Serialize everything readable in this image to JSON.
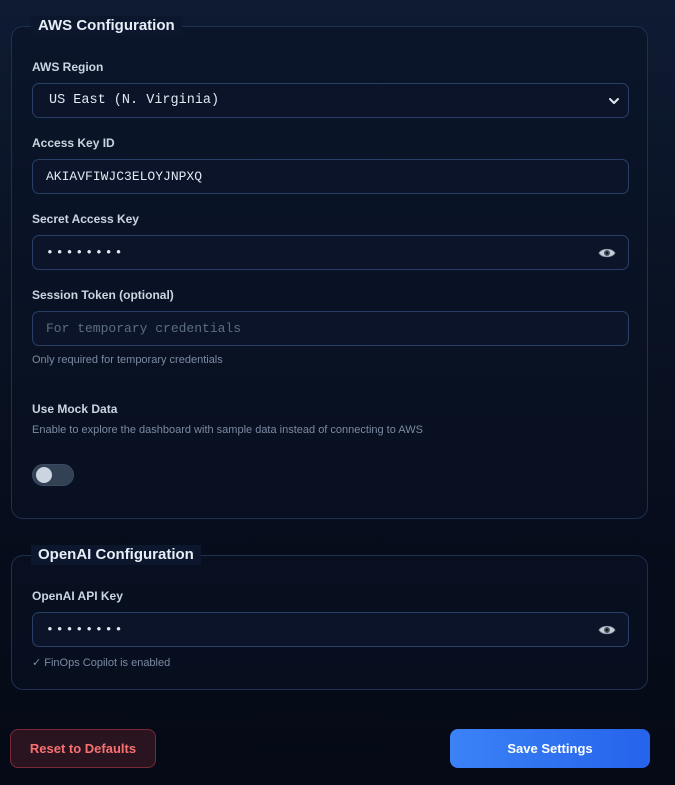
{
  "aws": {
    "title": "AWS Configuration",
    "region_label": "AWS Region",
    "region_value": "US East (N. Virginia)",
    "access_key_label": "Access Key ID",
    "access_key_value": "AKIAVFIWJC3ELOYJNPXQ",
    "secret_key_label": "Secret Access Key",
    "secret_key_value": "••••••••",
    "session_token_label": "Session Token (optional)",
    "session_token_placeholder": "For temporary credentials",
    "session_token_help": "Only required for temporary credentials",
    "mock_label": "Use Mock Data",
    "mock_help": "Enable to explore the dashboard with sample data instead of connecting to AWS",
    "mock_enabled": false
  },
  "openai": {
    "title": "OpenAI Configuration",
    "api_key_label": "OpenAI API Key",
    "api_key_value": "••••••••",
    "status": "✓ FinOps Copilot is enabled"
  },
  "actions": {
    "reset_label": "Reset to Defaults",
    "save_label": "Save Settings"
  },
  "icons": {
    "region_dropdown": "chevron-down-icon",
    "reveal": "eye-icon"
  },
  "colors": {
    "primary": "#3b82f6",
    "danger": "#f87171"
  }
}
